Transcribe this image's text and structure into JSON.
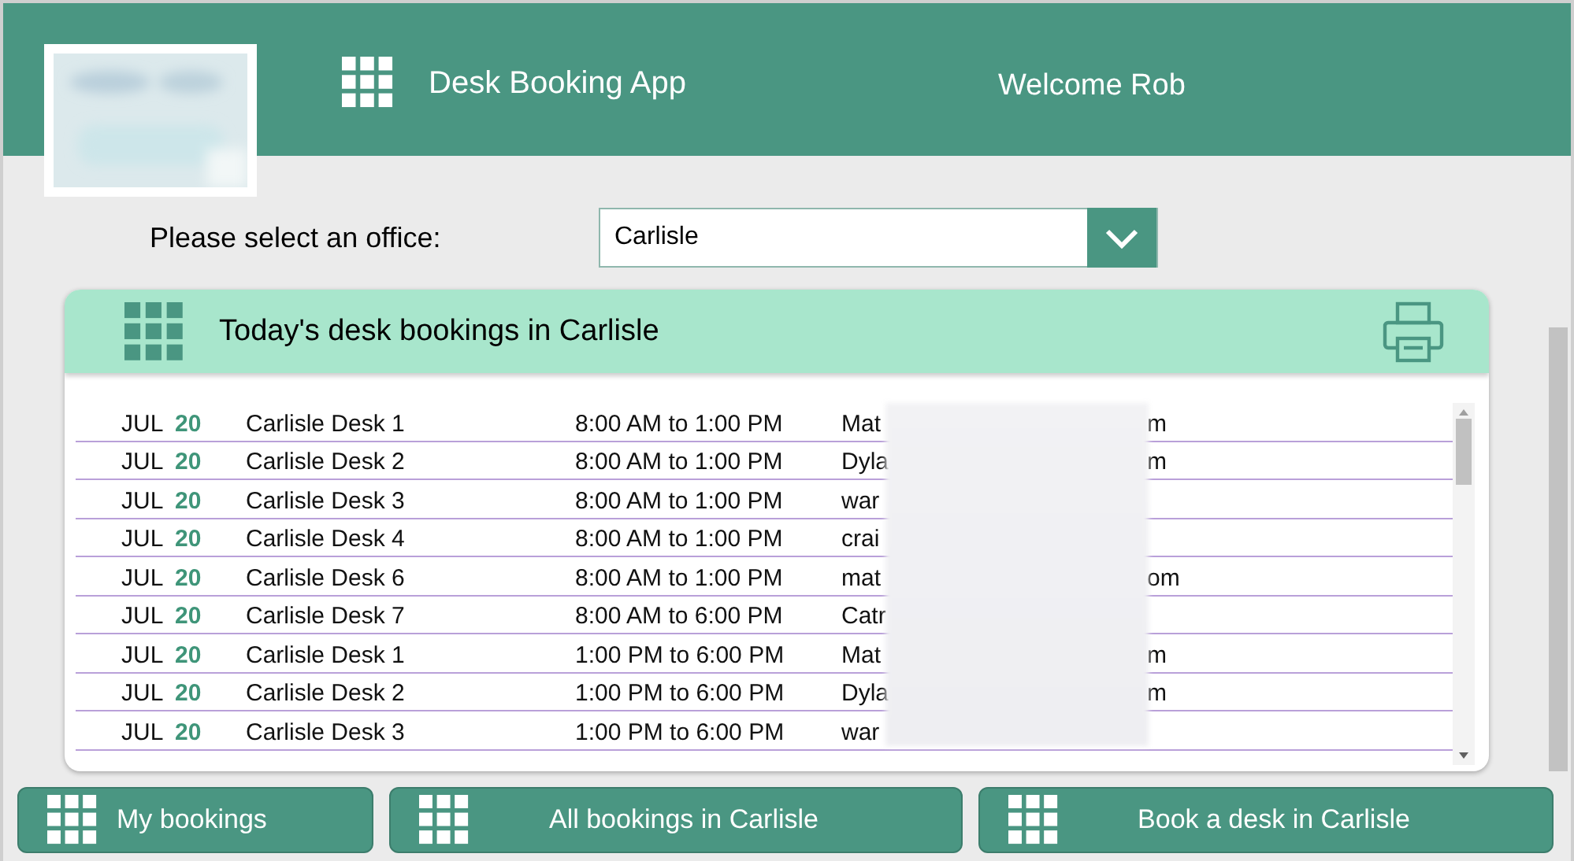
{
  "header": {
    "app_title": "Desk Booking App",
    "welcome": "Welcome Rob"
  },
  "office_select": {
    "label": "Please select an office:",
    "value": "Carlisle"
  },
  "bookings": {
    "title": "Today's desk bookings in Carlisle",
    "rows": [
      {
        "month": "JUL",
        "day": "20",
        "desk": "Carlisle Desk 1",
        "time": "8:00 AM to 1:00 PM",
        "email_start": "Mat",
        "email_end": "m"
      },
      {
        "month": "JUL",
        "day": "20",
        "desk": "Carlisle Desk 2",
        "time": "8:00 AM to 1:00 PM",
        "email_start": "Dyla",
        "email_end": "m"
      },
      {
        "month": "JUL",
        "day": "20",
        "desk": "Carlisle Desk 3",
        "time": "8:00 AM to 1:00 PM",
        "email_start": "war"
      },
      {
        "month": "JUL",
        "day": "20",
        "desk": "Carlisle Desk 4",
        "time": "8:00 AM to 1:00 PM",
        "email_start": "crai"
      },
      {
        "month": "JUL",
        "day": "20",
        "desk": "Carlisle Desk 6",
        "time": "8:00 AM to 1:00 PM",
        "email_start": "mat",
        "email_end": "om"
      },
      {
        "month": "JUL",
        "day": "20",
        "desk": "Carlisle Desk 7",
        "time": "8:00 AM to 6:00 PM",
        "email_start": "Catr"
      },
      {
        "month": "JUL",
        "day": "20",
        "desk": "Carlisle Desk 1",
        "time": "1:00 PM to 6:00 PM",
        "email_start": "Mat",
        "email_end": "m"
      },
      {
        "month": "JUL",
        "day": "20",
        "desk": "Carlisle Desk 2",
        "time": "1:00 PM to 6:00 PM",
        "email_start": "Dyla",
        "email_end": "m"
      },
      {
        "month": "JUL",
        "day": "20",
        "desk": "Carlisle Desk 3",
        "time": "1:00 PM to 6:00 PM",
        "email_start": "war"
      }
    ]
  },
  "buttons": [
    {
      "label": "My bookings",
      "kind": "left"
    },
    {
      "label": "All bookings in Carlisle",
      "kind": "center"
    },
    {
      "label": "Book a desk in Carlisle",
      "kind": "center"
    }
  ]
}
